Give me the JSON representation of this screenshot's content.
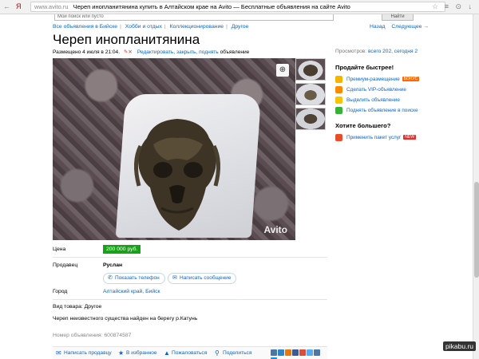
{
  "browser": {
    "nav_back": "←",
    "nav_yandex": "Я",
    "url_domain": "www.avito.ru",
    "url_title": "Череп инопланитянина купить в Алтайском крае на Avito — Бесплатные объявления на сайте Avito",
    "right_icons": "≡ ⊙ ↓"
  },
  "search": {
    "value": "Мой поиск или пусто",
    "button": "Найти"
  },
  "breadcrumbs": [
    "Все объявления в Бийске",
    "Хобби и отдых",
    "Коллекционирование",
    "Другое"
  ],
  "back_links": {
    "back": "Назад",
    "next": "Следующее →"
  },
  "title": "Череп инопланитянина",
  "meta": {
    "posted": "Размещено 4 июля в 21:04.",
    "edit_links": "Редактировать, закрыть, поднять",
    "suffix": "объявление"
  },
  "views": {
    "label": "Просмотров:",
    "value": "всего 202, сегодня 2"
  },
  "photo": {
    "watermark": "Avito",
    "zoom_icon": "magnifier-plus-icon"
  },
  "sidebar": {
    "sell_faster_title": "Продайте быстрее!",
    "items": [
      {
        "label": "Премиум-размещение",
        "badge": "БОНУС",
        "color": "#f4b400"
      },
      {
        "label": "Сделать VIP-объявление",
        "color": "#ff8a00"
      },
      {
        "label": "Выделить объявление",
        "color": "#f6c500"
      },
      {
        "label": "Поднять объявление в поиске",
        "color": "#36b336"
      }
    ],
    "want_more_title": "Хотите большего?",
    "more_item": {
      "label": "Применить пакет услуг",
      "badge": "NEW",
      "color": "#e94e2b"
    }
  },
  "details": {
    "price_label": "Цена",
    "price_value": "200 000 руб.",
    "seller_label": "Продавец",
    "seller_name": "Руслан",
    "show_phone": "Показать телефон",
    "write_message": "Написать сообщение",
    "city_label": "Город",
    "city_value": "Алтайский край, Бийск",
    "kind": "Вид товара: Другое",
    "description": "Череп неизвестного существа найден на берегу р.Катунь",
    "ad_number": "Номер объявления: 600874587"
  },
  "actions": {
    "write_friend": "Написать продавцу",
    "favorite": "В избранное",
    "complain": "Пожаловаться",
    "share": "Поделиться"
  },
  "social_colors": [
    "#4a76a8",
    "#2f83c9",
    "#e47911",
    "#3b5998",
    "#dd4b39",
    "#55acee",
    "#4a76a8",
    "#168de2"
  ],
  "corner_watermark": "pikabu.ru",
  "colors": {
    "link": "#0a65c8",
    "price_bg": "#19a119"
  }
}
